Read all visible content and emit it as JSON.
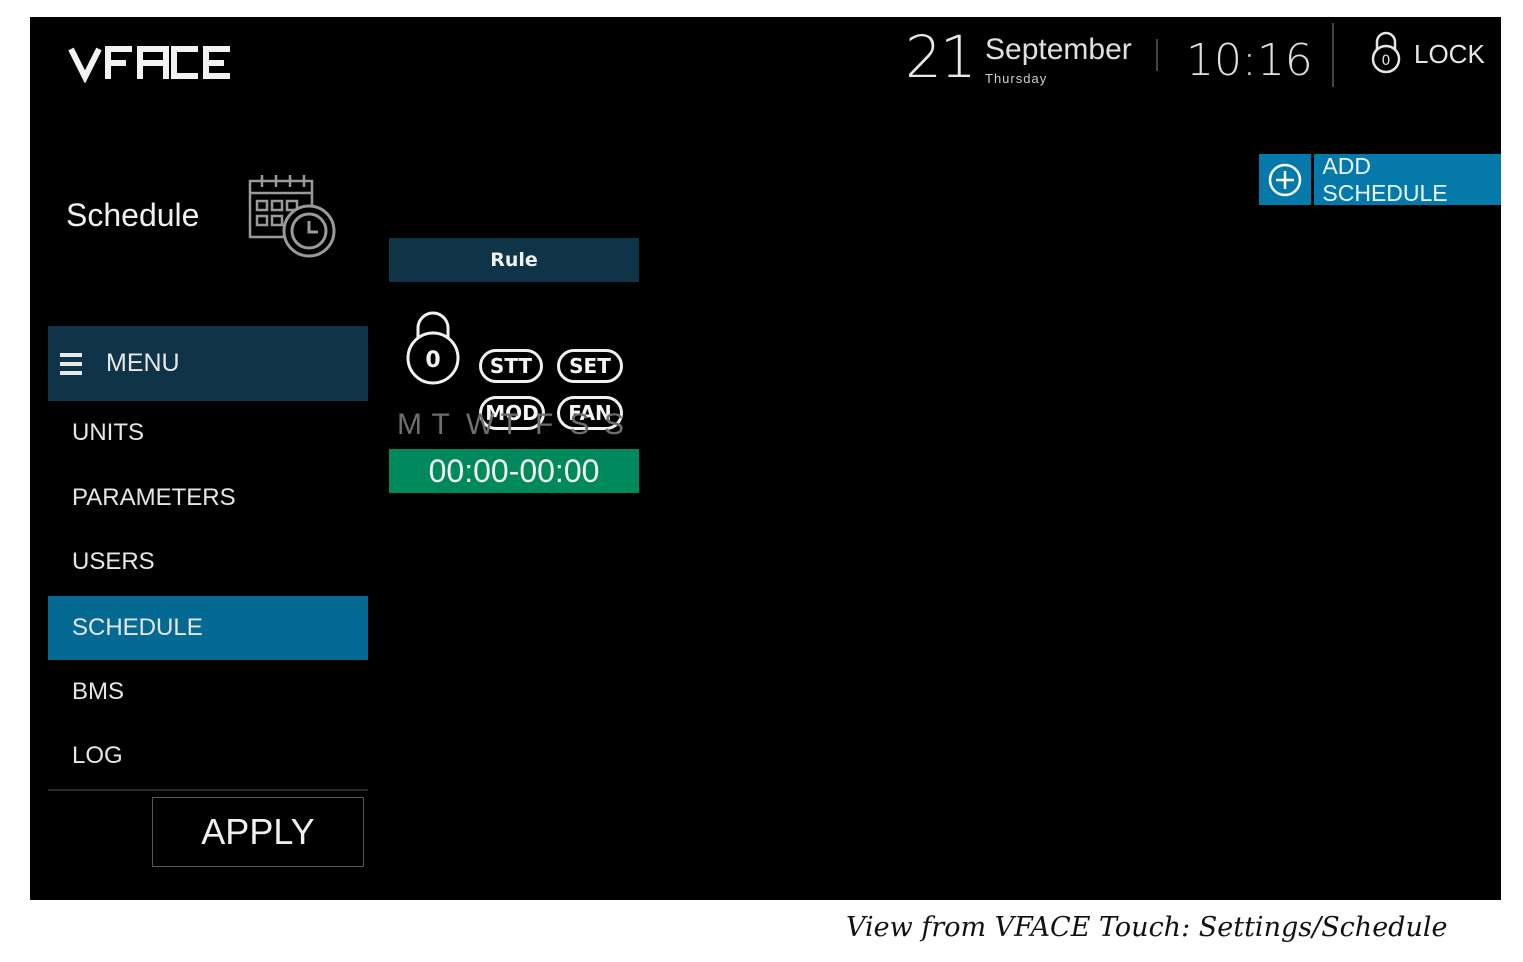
{
  "header": {
    "logo_text": "VFACE",
    "date_day_number": "21",
    "date_month": "September",
    "date_weekday": "Thursday",
    "time": "10:16",
    "lock_label": "LOCK",
    "lock_icon": "padlock-icon"
  },
  "sidebar": {
    "page_title": "Schedule",
    "page_icon": "calendar-clock-icon",
    "menu_label": "MENU",
    "menu_icon": "hamburger-icon",
    "items": [
      {
        "label": "UNITS",
        "active": false
      },
      {
        "label": "PARAMETERS",
        "active": false
      },
      {
        "label": "USERS",
        "active": false
      },
      {
        "label": "SCHEDULE",
        "active": true
      },
      {
        "label": "BMS",
        "active": false
      },
      {
        "label": "LOG",
        "active": false
      }
    ],
    "apply_label": "APPLY"
  },
  "actions": {
    "add_schedule_label": "ADD SCHEDULE",
    "add_icon": "plus-circle-icon"
  },
  "rule_card": {
    "header": "Rule",
    "lock_value": "0",
    "tags": [
      "STT",
      "SET",
      "MOD",
      "FAN"
    ],
    "days": [
      "M",
      "T",
      "W",
      "T",
      "F",
      "S",
      "S"
    ],
    "time_range": "00:00-00:00"
  },
  "caption": "View from VFACE Touch: Settings/Schedule",
  "colors": {
    "background": "#000000",
    "menu_header": "#0f3347",
    "active_item": "#046a94",
    "accent_blue": "#057aaa",
    "time_green": "#00895d"
  }
}
